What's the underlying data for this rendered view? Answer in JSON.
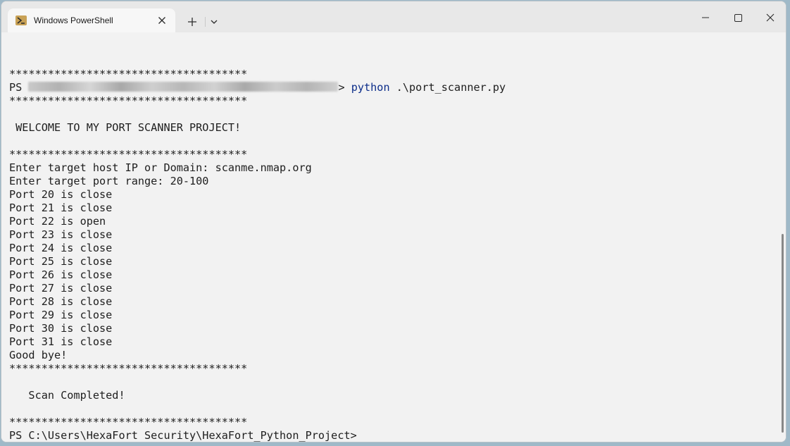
{
  "window": {
    "tab_title": "Windows PowerShell",
    "icon": "powershell-icon",
    "controls": [
      "minimize-icon",
      "maximize-icon",
      "close-icon"
    ]
  },
  "terminal": {
    "lines": {
      "l0": "*************************************",
      "l1_prefix": "PS ",
      "l1_mid": "> ",
      "l1_cmd": "python",
      "l1_arg": " .\\port_scanner.py",
      "l2": "*************************************",
      "l3": " WELCOME TO MY PORT SCANNER PROJECT!",
      "l4": "*************************************",
      "l5": "Enter target host IP or Domain: scanme.nmap.org",
      "l6": "Enter target port range: 20-100",
      "l7": "Port 20 is close",
      "l8": "Port 21 is close",
      "l9": "Port 22 is open",
      "l10": "Port 23 is close",
      "l11": "Port 24 is close",
      "l12": "Port 25 is close",
      "l13": "Port 26 is close",
      "l14": "Port 27 is close",
      "l15": "Port 28 is close",
      "l16": "Port 29 is close",
      "l17": "Port 30 is close",
      "l18": "Port 31 is close",
      "l19": "Good bye!",
      "l20": "*************************************",
      "l21": "   Scan Completed!",
      "l22": "*************************************",
      "l23": "PS C:\\Users\\HexaFort Security\\HexaFort_Python_Project>"
    }
  },
  "colors": {
    "background": "#f2f2f2",
    "text": "#1e1e1e",
    "command": "#0d2e8a"
  }
}
